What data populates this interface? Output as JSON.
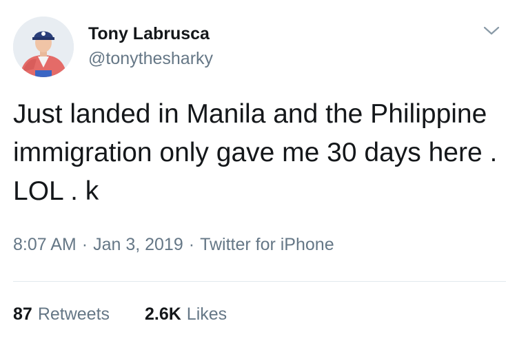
{
  "author": {
    "display_name": "Tony Labrusca",
    "handle": "@tonythesharky"
  },
  "menu_icon": "chevron-down-icon",
  "tweet": {
    "text": "Just landed in Manila and the Philippine immigration only gave me 30 days here . LOL . k",
    "time": "8:07 AM",
    "date": "Jan 3, 2019",
    "source": "Twitter for iPhone",
    "separator": "·"
  },
  "stats": {
    "retweets_count": "87",
    "retweets_label": "Retweets",
    "likes_count": "2.6K",
    "likes_label": "Likes"
  },
  "colors": {
    "text_primary": "#14171a",
    "text_secondary": "#657786",
    "divider": "#e1e8ed"
  }
}
